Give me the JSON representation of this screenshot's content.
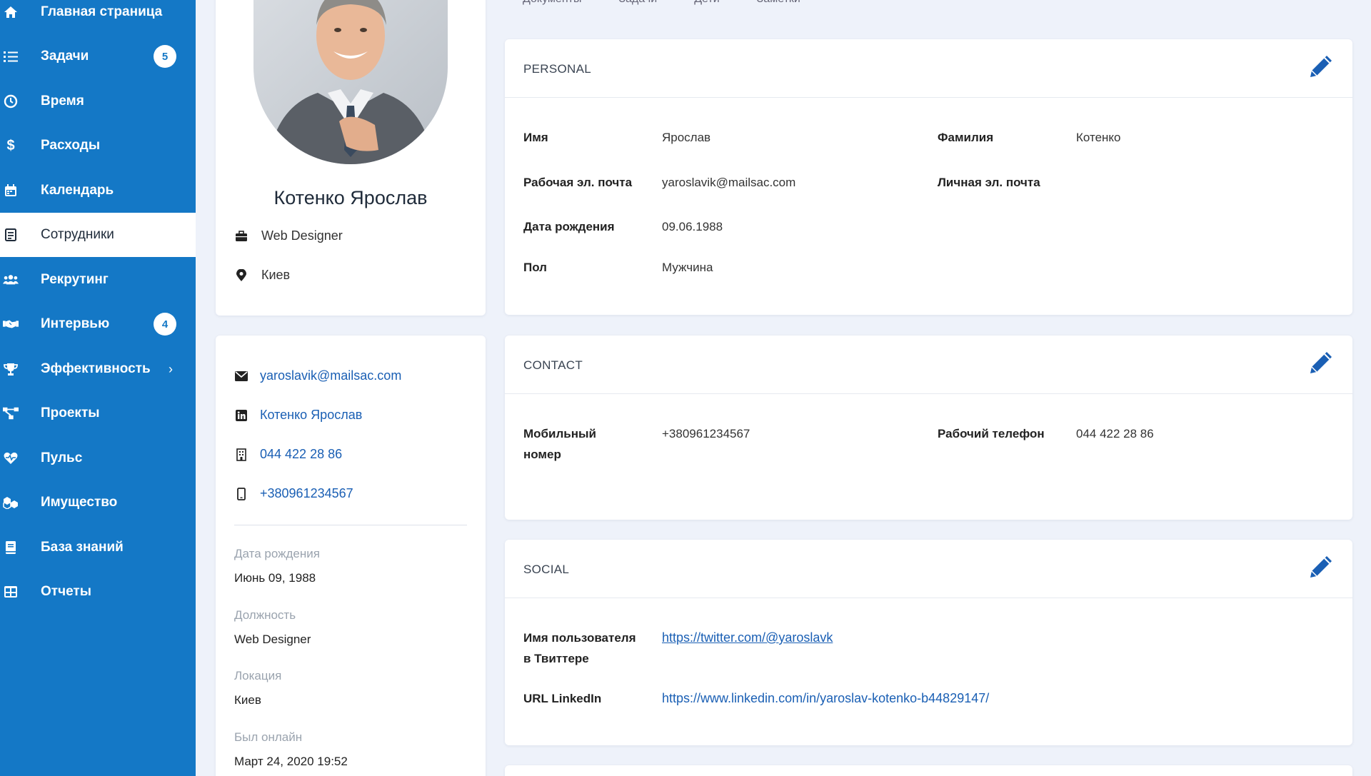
{
  "sidebar": {
    "items": [
      {
        "label": "Главная страница",
        "icon": "home-icon"
      },
      {
        "label": "Задачи",
        "icon": "tasks-icon",
        "badge": "5"
      },
      {
        "label": "Время",
        "icon": "clock-icon"
      },
      {
        "label": "Расходы",
        "icon": "dollar-icon"
      },
      {
        "label": "Календарь",
        "icon": "calendar-icon"
      },
      {
        "label": "Сотрудники",
        "icon": "employees-icon",
        "active": true
      },
      {
        "label": "Рекрутинг",
        "icon": "users-icon"
      },
      {
        "label": "Интервью",
        "icon": "handshake-icon",
        "badge": "4"
      },
      {
        "label": "Эффективность",
        "icon": "trophy-icon",
        "chevron": "›"
      },
      {
        "label": "Проекты",
        "icon": "projects-icon"
      },
      {
        "label": "Пульс",
        "icon": "heartbeat-icon"
      },
      {
        "label": "Имущество",
        "icon": "assets-icon"
      },
      {
        "label": "База знаний",
        "icon": "book-icon"
      },
      {
        "label": "Отчеты",
        "icon": "reports-icon"
      }
    ]
  },
  "tabs": [
    "Документы",
    "Задачи",
    "Дети",
    "Заметки"
  ],
  "profile": {
    "name": "Котенко Ярослав",
    "position": "Web Designer",
    "city": "Киев"
  },
  "contacts": {
    "email": "yaroslavik@mailsac.com",
    "linkedin": "Котенко Ярослав",
    "work_phone": "044 422 28 86",
    "mobile": "+380961234567"
  },
  "details": {
    "birth_label": "Дата рождения",
    "birth_value": "Июнь 09, 1988",
    "position_label": "Должность",
    "position_value": "Web Designer",
    "location_label": "Локация",
    "location_value": "Киев",
    "online_label": "Был онлайн",
    "online_value": "Март 24, 2020 19:52"
  },
  "personal": {
    "title": "PERSONAL",
    "first_name_label": "Имя",
    "first_name": "Ярослав",
    "last_name_label": "Фамилия",
    "last_name": "Котенко",
    "work_email_label": "Рабочая эл. почта",
    "work_email": "yaroslavik@mailsac.com",
    "personal_email_label": "Личная эл. почта",
    "personal_email": "",
    "birth_label": "Дата рождения",
    "birth": "09.06.1988",
    "gender_label": "Пол",
    "gender": "Мужчина"
  },
  "contact": {
    "title": "CONTACT",
    "mobile_label_1": "Мобильный",
    "mobile_label_2": "номер",
    "mobile": "+380961234567",
    "work_phone_label": "Рабочий телефон",
    "work_phone": "044 422 28 86"
  },
  "social": {
    "title": "SOCIAL",
    "twitter_label_1": "Имя пользователя",
    "twitter_label_2": "в Твиттере",
    "twitter": "https://twitter.com/@yaroslavk",
    "linkedin_label": "URL LinkedIn",
    "linkedin": "https://www.linkedin.com/in/yaroslav-kotenko-b44829147/"
  },
  "colors": {
    "sidebar": "#1478c6",
    "link": "#1a5fb4",
    "background": "#eef2fa"
  }
}
